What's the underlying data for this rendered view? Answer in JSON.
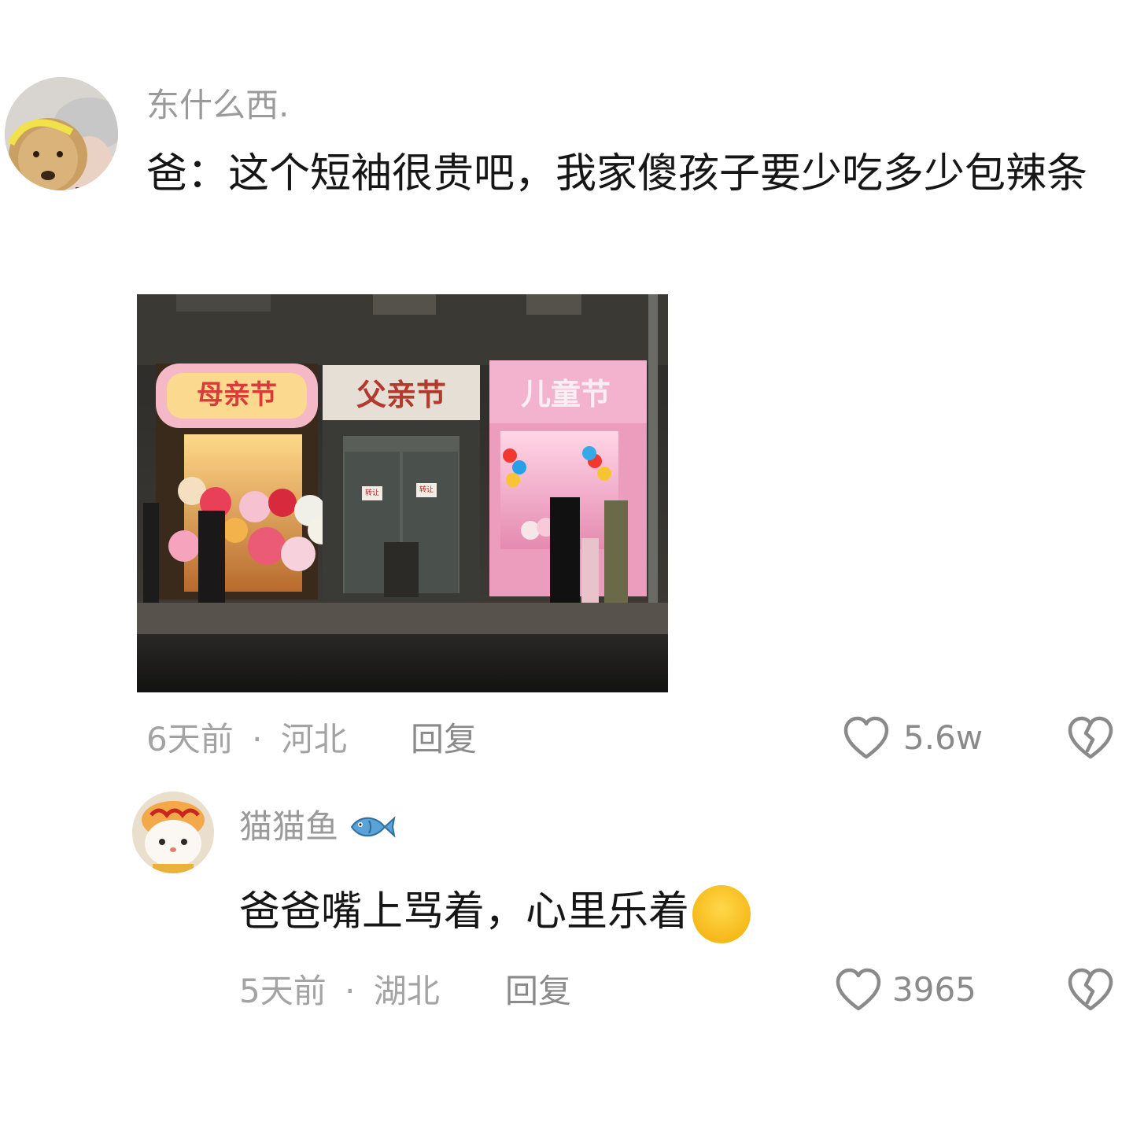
{
  "comments": [
    {
      "username": "东什么西.",
      "text": "爸：这个短袖很贵吧，我家傻孩子要少吃多少包辣条",
      "image_signs": [
        "母亲节",
        "父亲节",
        "儿童节"
      ],
      "image_notes": [
        "转让",
        "转让"
      ],
      "time": "6天前",
      "separator": "·",
      "location": "河北",
      "reply_label": "回复",
      "like_count": "5.6w",
      "like_icon": "heart-outline-icon",
      "dislike_icon": "broken-heart-icon"
    },
    {
      "username": "猫猫鱼",
      "username_badge": "fish-emoji",
      "text": "爸爸嘴上骂着，心里乐着",
      "text_emoji": "😂",
      "time": "5天前",
      "separator": "·",
      "location": "湖北",
      "reply_label": "回复",
      "like_count": "3965",
      "like_icon": "heart-outline-icon",
      "dislike_icon": "broken-heart-icon"
    }
  ]
}
